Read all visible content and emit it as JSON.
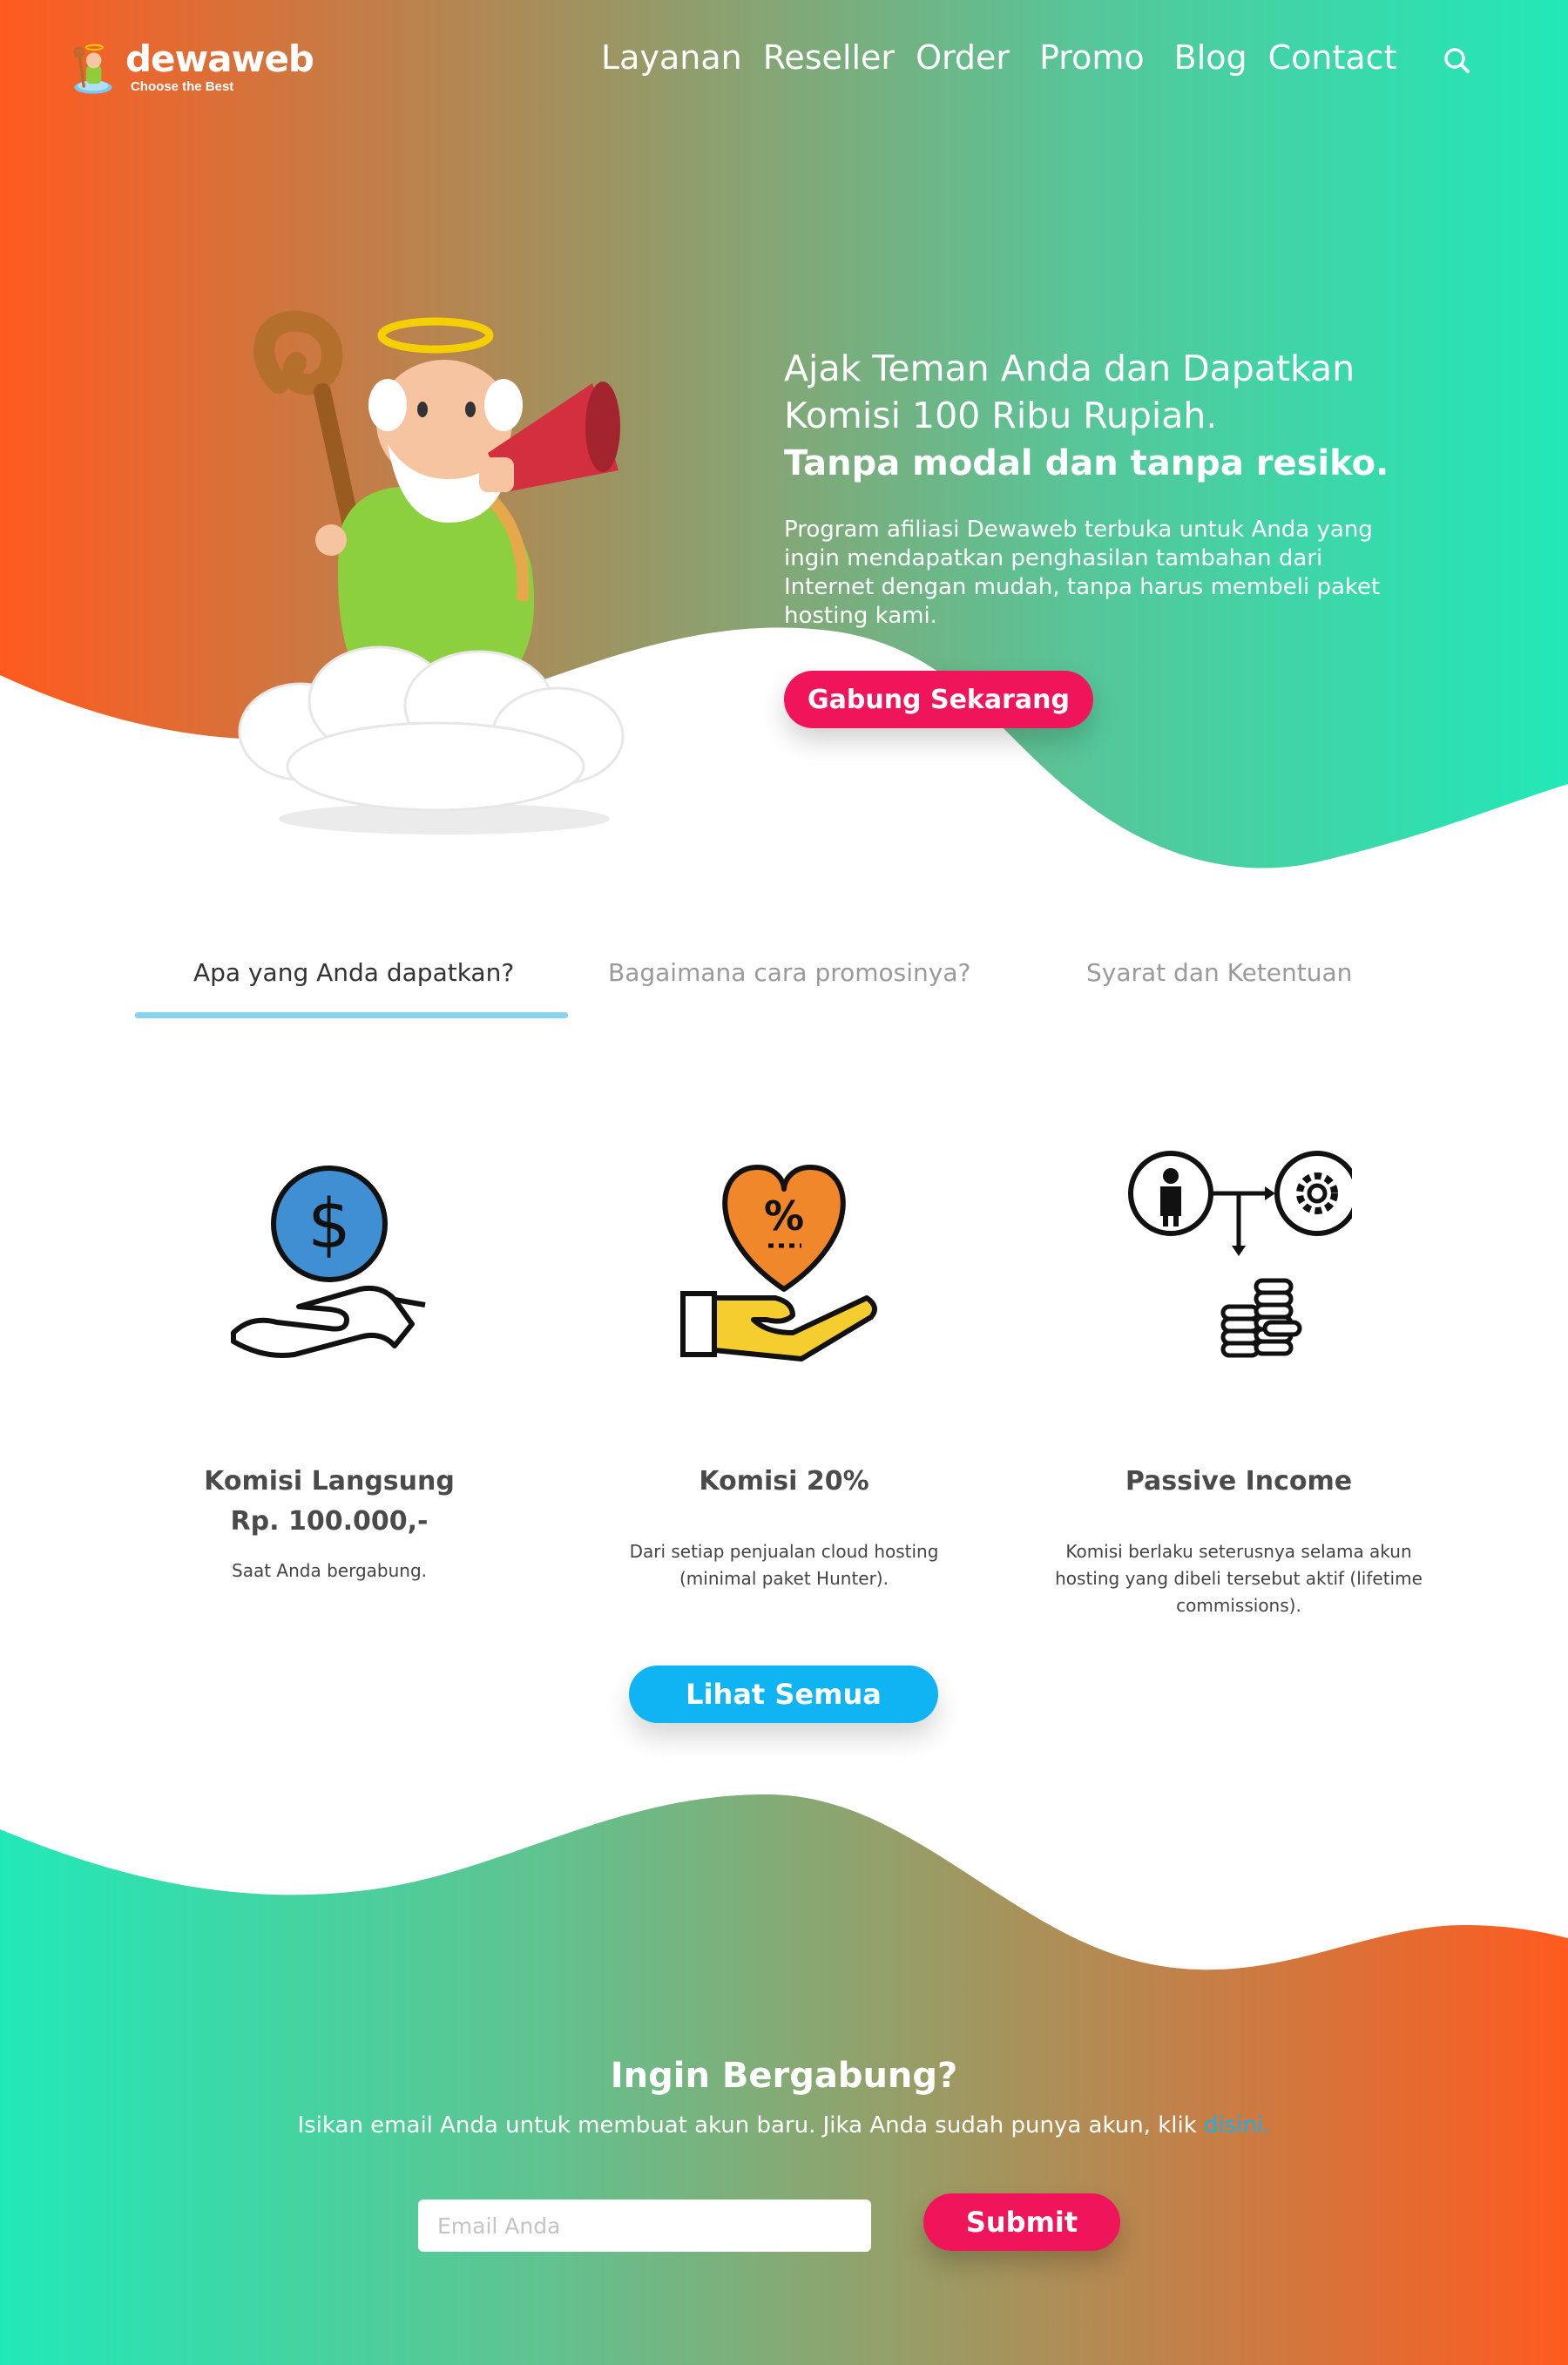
{
  "brand": {
    "name": "dewaweb",
    "tagline": "Choose the Best"
  },
  "nav": {
    "items": [
      {
        "label": "Layanan"
      },
      {
        "label": "Reseller"
      },
      {
        "label": "Order"
      },
      {
        "label": "Promo"
      },
      {
        "label": "Blog"
      },
      {
        "label": "Contact"
      }
    ],
    "search_icon": "search-icon"
  },
  "hero": {
    "heading_line1": "Ajak Teman Anda dan Dapatkan",
    "heading_line2": "Komisi 100 Ribu Rupiah.",
    "heading_bold": "Tanpa modal dan tanpa resiko.",
    "paragraph": "Program afiliasi Dewaweb terbuka untuk Anda yang ingin mendapatkan penghasilan tambahan dari Internet dengan mudah, tanpa harus membeli paket hosting kami.",
    "cta_label": "Gabung Sekarang"
  },
  "tabs": {
    "items": [
      {
        "label": "Apa yang Anda dapatkan?",
        "active": true
      },
      {
        "label": "Bagaimana cara promosinya?",
        "active": false
      },
      {
        "label": "Syarat dan Ketentuan",
        "active": false
      }
    ]
  },
  "features": [
    {
      "icon": "hand-dollar-icon",
      "title": "Komisi Langsung",
      "subtitle": "Rp. 100.000,-",
      "description": "Saat Anda bergabung."
    },
    {
      "icon": "heart-percent-hand-icon",
      "title": "Komisi 20%",
      "subtitle": "",
      "description": "Dari setiap penjualan cloud hosting (minimal paket Hunter)."
    },
    {
      "icon": "passive-income-icon",
      "title": "Passive Income",
      "subtitle": "",
      "description": "Komisi berlaku seterusnya selama akun hosting yang dibeli tersebut aktif (lifetime commissions)."
    }
  ],
  "see_all_label": "Lihat Semua",
  "join": {
    "title": "Ingin Bergabung?",
    "text": "Isikan email Anda untuk membuat akun baru. Jika Anda sudah punya akun, klik",
    "link_label": "disini.",
    "email_placeholder": "Email Anda",
    "submit_label": "Submit"
  },
  "colors": {
    "orange": "#ff5a1f",
    "teal": "#22e8b8",
    "pink": "#f0155a",
    "blue": "#10b4f3",
    "tab_underline": "#8ad3ee"
  }
}
